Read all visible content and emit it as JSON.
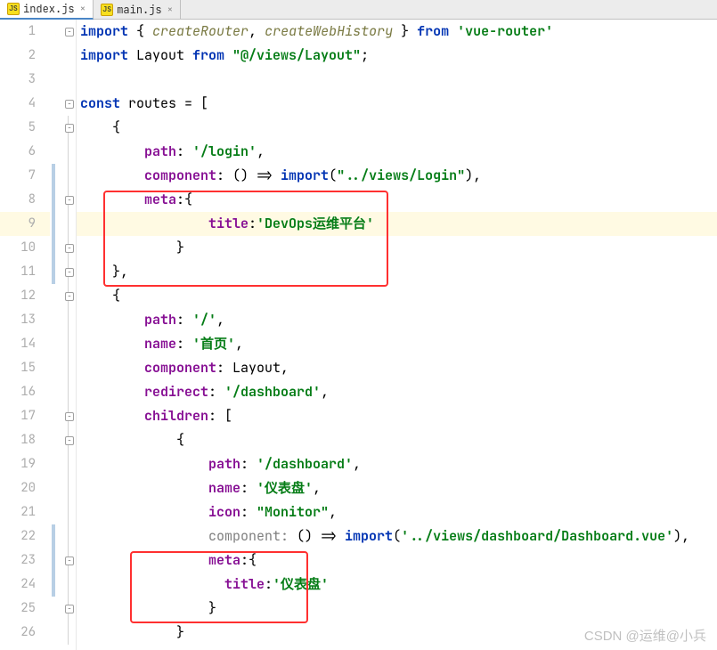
{
  "tabs": [
    {
      "label": "index.js",
      "active": true
    },
    {
      "label": "main.js",
      "active": false
    }
  ],
  "icons": {
    "js": "JS",
    "close": "×",
    "collapse": "−"
  },
  "lines": {
    "n1": "1",
    "n2": "2",
    "n3": "3",
    "n4": "4",
    "n5": "5",
    "n6": "6",
    "n7": "7",
    "n8": "8",
    "n9": "9",
    "n10": "10",
    "n11": "11",
    "n12": "12",
    "n13": "13",
    "n14": "14",
    "n15": "15",
    "n16": "16",
    "n17": "17",
    "n18": "18",
    "n19": "19",
    "n20": "20",
    "n21": "21",
    "n22": "22",
    "n23": "23",
    "n24": "24",
    "n25": "25",
    "n26": "26"
  },
  "code": {
    "l1": {
      "kw1": "import",
      "br1": "{ ",
      "id1": "createRouter",
      "c1": ", ",
      "id2": "createWebHistory",
      "br2": " }",
      "kw2": " from ",
      "str": "'vue-router'"
    },
    "l2": {
      "kw1": "import",
      "sp1": " Layout ",
      "kw2": "from ",
      "str": "\"@/views/Layout\"",
      "sc": ";"
    },
    "l4": {
      "kw": "const ",
      "id": "routes",
      "eq": " = ["
    },
    "l5": {
      "t": "    {"
    },
    "l6": {
      "ind": "        ",
      "prop": "path",
      "c": ": ",
      "str": "'/login'",
      "e": ","
    },
    "l7": {
      "ind": "        ",
      "prop": "component",
      "c": ": () => ",
      "fn": "import",
      "p1": "(",
      "str": "\"../views/Login\"",
      "p2": "),"
    },
    "l8": {
      "ind": "        ",
      "prop": "meta",
      "c": ":{"
    },
    "l9": {
      "ind": "                ",
      "prop": "title",
      "c": ":",
      "str": "'DevOps运维平台'"
    },
    "l10": {
      "t": "            }"
    },
    "l11": {
      "t": "    },"
    },
    "l12": {
      "t": "    {"
    },
    "l13": {
      "ind": "        ",
      "prop": "path",
      "c": ": ",
      "str": "'/'",
      "e": ","
    },
    "l14": {
      "ind": "        ",
      "prop": "name",
      "c": ": ",
      "str": "'首页'",
      "e": ","
    },
    "l15": {
      "ind": "        ",
      "prop": "component",
      "c": ": Layout,"
    },
    "l16": {
      "ind": "        ",
      "prop": "redirect",
      "c": ": ",
      "str": "'/dashboard'",
      "e": ","
    },
    "l17": {
      "ind": "        ",
      "prop": "children",
      "c": ": ["
    },
    "l18": {
      "t": "            {"
    },
    "l19": {
      "ind": "                ",
      "prop": "path",
      "c": ": ",
      "str": "'/dashboard'",
      "e": ","
    },
    "l20": {
      "ind": "                ",
      "prop": "name",
      "c": ": ",
      "str": "'仪表盘'",
      "e": ","
    },
    "l21": {
      "ind": "                ",
      "prop": "icon",
      "c": ": ",
      "str": "\"Monitor\"",
      "e": ","
    },
    "l22": {
      "ind": "                ",
      "gray": "component: ",
      "arr": "() => ",
      "fn": "import",
      "p1": "(",
      "str": "'../views/dashboard/Dashboard.vue'",
      "p2": "),"
    },
    "l23": {
      "ind": "                ",
      "prop": "meta",
      "c": ":{"
    },
    "l24": {
      "ind": "                  ",
      "prop": "title",
      "c": ":",
      "str": "'仪表盘'"
    },
    "l25": {
      "t": "                }"
    },
    "l26": {
      "t": "            }"
    }
  },
  "watermark": "CSDN @运维@小兵"
}
